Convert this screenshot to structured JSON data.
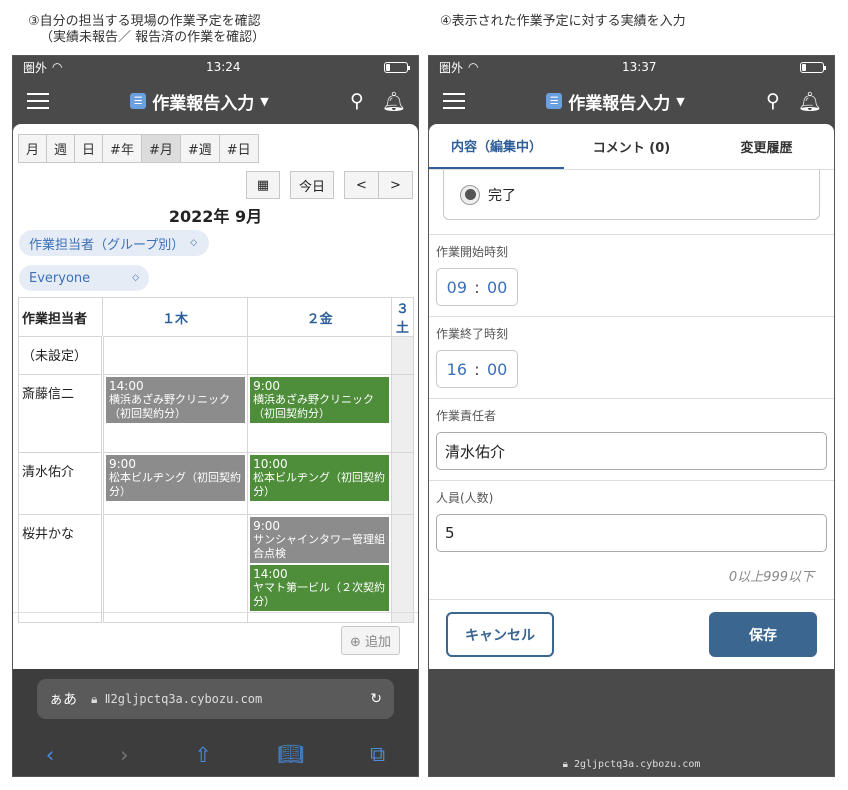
{
  "captions": {
    "left_line1": "③自分の担当する現場の作業予定を確認",
    "left_line2": "（実績未報告／ 報告済の作業を確認）",
    "right": "④表示された作業予定に対する実績を入力"
  },
  "status_left": {
    "carrier": "圏外",
    "time": "13:24"
  },
  "status_right": {
    "carrier": "圏外",
    "time": "13:37"
  },
  "app": {
    "title": "作業報告入力"
  },
  "schedule": {
    "view_buttons": [
      {
        "label": "月",
        "active": false
      },
      {
        "label": "週",
        "active": false
      },
      {
        "label": "日",
        "active": false
      },
      {
        "label": "#年",
        "active": false
      },
      {
        "label": "#月",
        "active": true
      },
      {
        "label": "#週",
        "active": false
      },
      {
        "label": "#日",
        "active": false
      }
    ],
    "today_label": "今日",
    "prev": "<",
    "next": ">",
    "month_title": "2022年 9月",
    "group_select": "作業担当者（グループ別）",
    "member_select": "Everyone",
    "header": {
      "name_col": "作業担当者",
      "day1": "１木",
      "day2": "２金",
      "day3": "３土"
    },
    "rows": [
      {
        "name": "（未設定）",
        "day1": [],
        "day2": []
      },
      {
        "name": "斎藤信二",
        "day1": [
          {
            "time": "14:00",
            "text": "横浜あざみ野クリニック（初回契約分）",
            "color": "gray"
          }
        ],
        "day2": [
          {
            "time": "9:00",
            "text": "横浜あざみ野クリニック（初回契約分）",
            "color": "green"
          }
        ]
      },
      {
        "name": "清水佑介",
        "day1": [
          {
            "time": "9:00",
            "text": "松本ビルヂング（初回契約分）",
            "color": "gray"
          }
        ],
        "day2": [
          {
            "time": "10:00",
            "text": "松本ビルヂング（初回契約分）",
            "color": "green"
          }
        ]
      },
      {
        "name": "桜井かな",
        "day1": [],
        "day2": [
          {
            "time": "9:00",
            "text": "サンシャインタワー管理組合点検",
            "color": "gray"
          },
          {
            "time": "14:00",
            "text": "ヤマト第一ビル（２次契約分）",
            "color": "green"
          }
        ]
      }
    ],
    "add_label": "追加"
  },
  "browser": {
    "aa": "ぁあ",
    "url": "Ⅱ2gljpctq3a.cybozu.com"
  },
  "form": {
    "tabs": [
      "内容（編集中）",
      "コメント (0)",
      "変更履歴"
    ],
    "status_option": "完了",
    "start_label": "作業開始時刻",
    "start_h": "09",
    "start_m": "00",
    "end_label": "作業終了時刻",
    "end_h": "16",
    "end_m": "00",
    "manager_label": "作業責任者",
    "manager_value": "清水佑介",
    "people_label": "人員(人数)",
    "people_value": "5",
    "people_hint": "0以上999以下",
    "cancel": "キャンセル",
    "save": "保存",
    "footer_url": "2gljpctq3a.cybozu.com"
  },
  "colors": {
    "gray_event": "#8c8c8c",
    "green_event": "#4e8d3a",
    "accent": "#3a6690",
    "link": "#3b70b9"
  }
}
